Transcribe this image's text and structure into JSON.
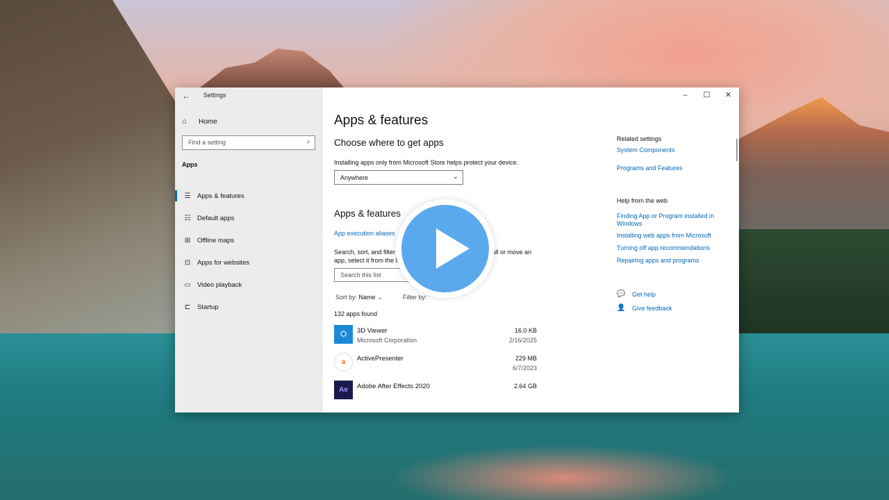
{
  "window": {
    "title": "Settings",
    "back_icon": "←",
    "minimize_icon": "–",
    "maximize_icon": "☐",
    "close_icon": "✕"
  },
  "sidebar": {
    "home_icon": "⌂",
    "home_label": "Home",
    "search_placeholder": "Find a setting",
    "search_icon": "⌕",
    "section": "Apps",
    "items": [
      {
        "label": "Apps & features",
        "icon": "☰",
        "active": true
      },
      {
        "label": "Default apps",
        "icon": "☷",
        "active": false
      },
      {
        "label": "Offline maps",
        "icon": "⊞",
        "active": false
      },
      {
        "label": "Apps for websites",
        "icon": "⊡",
        "active": false
      },
      {
        "label": "Video playback",
        "icon": "▭",
        "active": false
      },
      {
        "label": "Startup",
        "icon": "⊏",
        "active": false
      }
    ]
  },
  "main": {
    "title": "Apps & features",
    "choose_heading": "Choose where to get apps",
    "choose_desc": "Installing apps only from Microsoft Store helps protect your device.",
    "dropdown_value": "Anywhere",
    "dropdown_chevron": "⌄",
    "apps_heading": "Apps & features",
    "alias_link": "App execution aliases",
    "search_desc": "Search, sort, and filter by drive. If you would like to uninstall or move an app, select it from the list.",
    "list_search_placeholder": "Search this list",
    "sort_label": "Sort by:",
    "sort_value": "Name",
    "sort_chevron": "⌄",
    "filter_label": "Filter by:",
    "count": "132 apps found",
    "apps": [
      {
        "name": "3D Viewer",
        "publisher": "Microsoft Corporation",
        "size": "16.0 KB",
        "date": "2/16/2025",
        "icon_text": "⬡",
        "icon_color": "#1e88d8"
      },
      {
        "name": "ActivePresenter",
        "publisher": "",
        "size": "229 MB",
        "date": "6/7/2023",
        "icon_text": "a",
        "icon_color": "#f06c2c"
      },
      {
        "name": "Adobe After Effects 2020",
        "publisher": "",
        "size": "2.64 GB",
        "date": "",
        "icon_text": "Ae",
        "icon_color": "#1a1a4e"
      }
    ]
  },
  "related": {
    "heading": "Related settings",
    "links": [
      "System Components",
      "Programs and Features"
    ],
    "web_heading": "Help from the web",
    "web_links": [
      "Finding App or Program installed in Windows",
      "Installing web apps from Microsoft",
      "Turning off app recommendations",
      "Repairing apps and programs"
    ],
    "get_help": "Get help",
    "give_feedback": "Give feedback"
  },
  "colors": {
    "accent": "#0067b8",
    "play_button": "#5aa9ec"
  }
}
